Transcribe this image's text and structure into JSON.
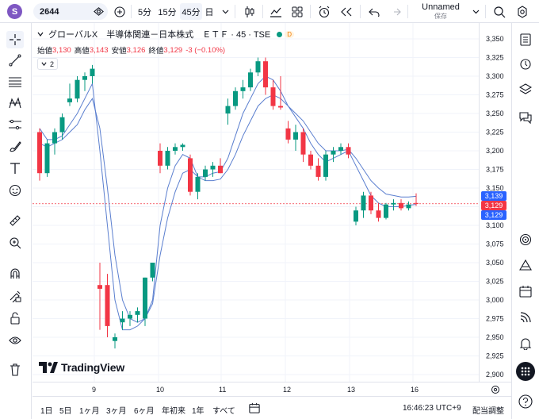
{
  "topbar": {
    "avatar_letter": "S",
    "symbol": "2644",
    "timeframes": [
      "5分",
      "15分",
      "45分",
      "日"
    ],
    "active_timeframe": "45分",
    "layout_name": "Unnamed",
    "layout_status": "保存"
  },
  "legend": {
    "name": "グローバルX　半導体関連－日本株式　ＥＴＦ · 45 · TSE",
    "badge": "D",
    "ohlc": [
      {
        "label": "始値",
        "value": "3,130"
      },
      {
        "label": "高値",
        "value": "3,143"
      },
      {
        "label": "安値",
        "value": "3,126"
      },
      {
        "label": "終値",
        "value": "3,129"
      }
    ],
    "change": "-3 (−0.10%)",
    "indicator_count": "2"
  },
  "price_axis": {
    "ticks": [
      "3,350",
      "3,325",
      "3,300",
      "3,275",
      "3,250",
      "3,225",
      "3,200",
      "3,175",
      "3,150",
      "3,125",
      "3,100",
      "3,075",
      "3,050",
      "3,025",
      "3,000",
      "2,975",
      "2,950",
      "2,925",
      "2,900"
    ],
    "labels": [
      {
        "text": "3,139",
        "color": "#2962ff"
      },
      {
        "text": "3,129",
        "color": "#f23645"
      },
      {
        "text": "3,129",
        "color": "#2962ff"
      }
    ]
  },
  "time_axis": {
    "ticks": [
      "9",
      "10",
      "11",
      "12",
      "13",
      "16"
    ]
  },
  "watermark": "TradingView",
  "bottombar": {
    "ranges": [
      "1日",
      "5日",
      "1ヶ月",
      "3ヶ月",
      "6ヶ月",
      "年初来",
      "1年",
      "すべて"
    ],
    "clock": "16:46:23 UTC+9",
    "adjust": "配当調整"
  },
  "chart_data": {
    "type": "candlestick",
    "symbol": "2644",
    "interval": "45",
    "ylim": [
      2900,
      3350
    ],
    "candles": [
      {
        "o": 3225,
        "h": 3230,
        "l": 3160,
        "c": 3170
      },
      {
        "o": 3170,
        "h": 3215,
        "l": 3165,
        "c": 3210
      },
      {
        "o": 3210,
        "h": 3230,
        "l": 3195,
        "c": 3225
      },
      {
        "o": 3225,
        "h": 3250,
        "l": 3215,
        "c": 3245
      },
      {
        "o": 3265,
        "h": 3290,
        "l": 3260,
        "c": 3270
      },
      {
        "o": 3270,
        "h": 3300,
        "l": 3265,
        "c": 3295
      },
      {
        "o": 3295,
        "h": 3305,
        "l": 3280,
        "c": 3300
      },
      {
        "o": 3300,
        "h": 3315,
        "l": 3290,
        "c": 3310
      },
      {
        "o": 3020,
        "h": 3050,
        "l": 2960,
        "c": 3015
      },
      {
        "o": 3020,
        "h": 3035,
        "l": 2950,
        "c": 2965
      },
      {
        "o": 2945,
        "h": 2955,
        "l": 2935,
        "c": 2950
      },
      {
        "o": 2970,
        "h": 2985,
        "l": 2960,
        "c": 2975
      },
      {
        "o": 2975,
        "h": 2985,
        "l": 2965,
        "c": 2980
      },
      {
        "o": 2980,
        "h": 2990,
        "l": 2970,
        "c": 2985
      },
      {
        "o": 2975,
        "h": 3030,
        "l": 2965,
        "c": 3030
      },
      {
        "o": 3030,
        "h": 3050,
        "l": 3025,
        "c": 3050
      },
      {
        "o": 3200,
        "h": 3210,
        "l": 3170,
        "c": 3180
      },
      {
        "o": 3180,
        "h": 3205,
        "l": 3175,
        "c": 3200
      },
      {
        "o": 3200,
        "h": 3210,
        "l": 3195,
        "c": 3205
      },
      {
        "o": 3205,
        "h": 3210,
        "l": 3200,
        "c": 3208
      },
      {
        "o": 3190,
        "h": 3195,
        "l": 3140,
        "c": 3145
      },
      {
        "o": 3145,
        "h": 3170,
        "l": 3135,
        "c": 3165
      },
      {
        "o": 3165,
        "h": 3180,
        "l": 3160,
        "c": 3175
      },
      {
        "o": 3175,
        "h": 3185,
        "l": 3165,
        "c": 3180
      },
      {
        "o": 3180,
        "h": 3190,
        "l": 3170,
        "c": 3170
      },
      {
        "o": 3250,
        "h": 3270,
        "l": 3235,
        "c": 3260
      },
      {
        "o": 3260,
        "h": 3285,
        "l": 3255,
        "c": 3280
      },
      {
        "o": 3280,
        "h": 3295,
        "l": 3270,
        "c": 3285
      },
      {
        "o": 3285,
        "h": 3310,
        "l": 3280,
        "c": 3305
      },
      {
        "o": 3305,
        "h": 3325,
        "l": 3300,
        "c": 3320
      },
      {
        "o": 3320,
        "h": 3325,
        "l": 3275,
        "c": 3285
      },
      {
        "o": 3285,
        "h": 3295,
        "l": 3255,
        "c": 3260
      },
      {
        "o": 3260,
        "h": 3300,
        "l": 3255,
        "c": 3258
      },
      {
        "o": 3230,
        "h": 3240,
        "l": 3210,
        "c": 3215
      },
      {
        "o": 3215,
        "h": 3235,
        "l": 3200,
        "c": 3225
      },
      {
        "o": 3225,
        "h": 3230,
        "l": 3185,
        "c": 3195
      },
      {
        "o": 3195,
        "h": 3200,
        "l": 3175,
        "c": 3180
      },
      {
        "o": 3180,
        "h": 3190,
        "l": 3160,
        "c": 3165
      },
      {
        "o": 3165,
        "h": 3200,
        "l": 3160,
        "c": 3195
      },
      {
        "o": 3195,
        "h": 3205,
        "l": 3185,
        "c": 3200
      },
      {
        "o": 3200,
        "h": 3210,
        "l": 3195,
        "c": 3205
      },
      {
        "o": 3205,
        "h": 3210,
        "l": 3190,
        "c": 3195
      },
      {
        "o": 3105,
        "h": 3125,
        "l": 3100,
        "c": 3120
      },
      {
        "o": 3120,
        "h": 3145,
        "l": 3110,
        "c": 3140
      },
      {
        "o": 3140,
        "h": 3145,
        "l": 3115,
        "c": 3120
      },
      {
        "o": 3120,
        "h": 3130,
        "l": 3105,
        "c": 3110
      },
      {
        "o": 3110,
        "h": 3130,
        "l": 3108,
        "c": 3128
      },
      {
        "o": 3128,
        "h": 3135,
        "l": 3120,
        "c": 3130
      },
      {
        "o": 3130,
        "h": 3135,
        "l": 3120,
        "c": 3123
      },
      {
        "o": 3123,
        "h": 3132,
        "l": 3120,
        "c": 3128
      },
      {
        "o": 3130,
        "h": 3143,
        "l": 3126,
        "c": 3129
      }
    ],
    "ma_fast": [
      3230,
      3215,
      3215,
      3220,
      3235,
      3250,
      3270,
      3290,
      3200,
      3100,
      3000,
      2960,
      2960,
      2965,
      2975,
      3000,
      3100,
      3150,
      3180,
      3195,
      3190,
      3165,
      3165,
      3170,
      3172,
      3190,
      3220,
      3250,
      3270,
      3290,
      3300,
      3295,
      3280,
      3260,
      3245,
      3230,
      3210,
      3195,
      3185,
      3190,
      3195,
      3200,
      3180,
      3160,
      3140,
      3130,
      3125,
      3125,
      3125,
      3127,
      3128
    ],
    "ma_slow": [
      3210,
      3205,
      3210,
      3215,
      3225,
      3235,
      3255,
      3270,
      3230,
      3150,
      3060,
      3000,
      2975,
      2970,
      2975,
      2995,
      3060,
      3110,
      3145,
      3170,
      3175,
      3165,
      3160,
      3160,
      3162,
      3175,
      3195,
      3220,
      3240,
      3260,
      3270,
      3275,
      3270,
      3260,
      3250,
      3240,
      3225,
      3210,
      3200,
      3200,
      3200,
      3202,
      3190,
      3175,
      3160,
      3150,
      3142,
      3140,
      3138,
      3138,
      3139
    ]
  },
  "colors": {
    "up": "#089981",
    "down": "#f23645",
    "ma": "#5b7fcf",
    "accent": "#2962ff"
  }
}
